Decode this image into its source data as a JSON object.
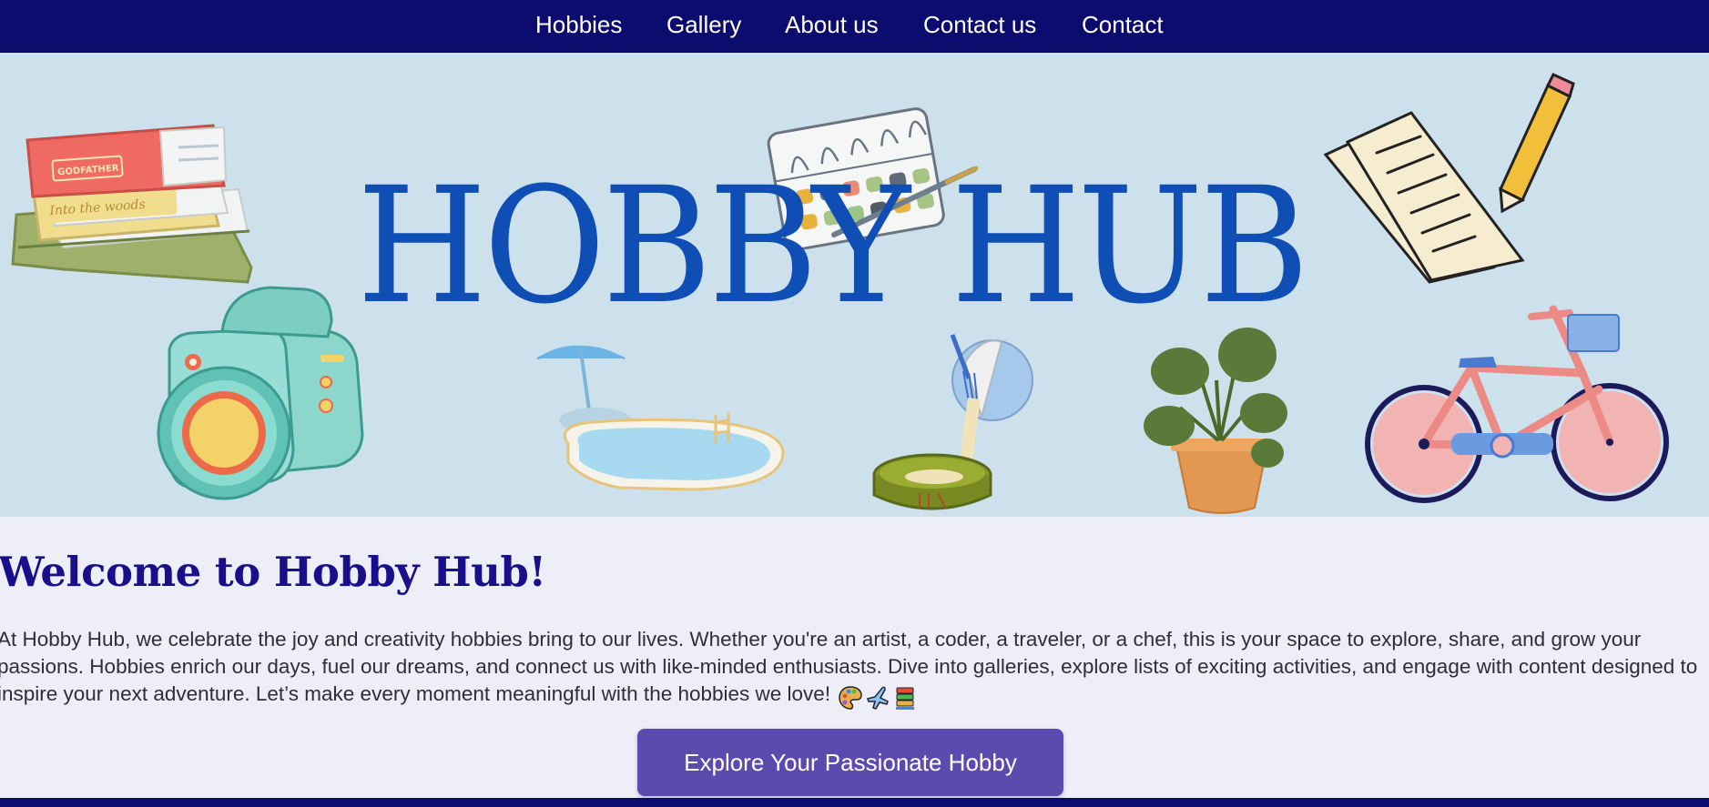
{
  "nav": {
    "items": [
      {
        "label": "Hobbies"
      },
      {
        "label": "Gallery"
      },
      {
        "label": "About us"
      },
      {
        "label": "Contact us"
      },
      {
        "label": "Contact"
      }
    ]
  },
  "hero": {
    "title": "HOBBY HUB",
    "book_spine_1": "GODFATHER",
    "book_spine_2": "Into the woods",
    "icons": [
      "books-icon",
      "paint-palette-icon",
      "paper-pencil-icon",
      "camera-icon",
      "swimming-pool-icon",
      "baking-icon",
      "potted-plant-icon",
      "bicycle-icon"
    ]
  },
  "main": {
    "heading": "Welcome to Hobby Hub!",
    "paragraph": "At Hobby Hub, we celebrate the joy and creativity hobbies bring to our lives. Whether you're an artist, a coder, a traveler, or a chef, this is your space to explore, share, and grow your passions. Hobbies enrich our days, fuel our dreams, and connect us with like-minded enthusiasts. Dive into galleries, explore lists of exciting activities, and engage with content designed to inspire your next adventure. Let’s make every moment meaningful with the hobbies we love!",
    "emojis": [
      "palette-emoji",
      "airplane-emoji",
      "books-emoji"
    ],
    "cta_label": "Explore Your Passionate Hobby"
  },
  "colors": {
    "nav_bg": "#0c0b6e",
    "hero_bg": "#cde1ed",
    "title": "#0f4eb5",
    "heading": "#1a0f8a",
    "page_bg": "#eeeef8",
    "button": "#5b4bae"
  }
}
